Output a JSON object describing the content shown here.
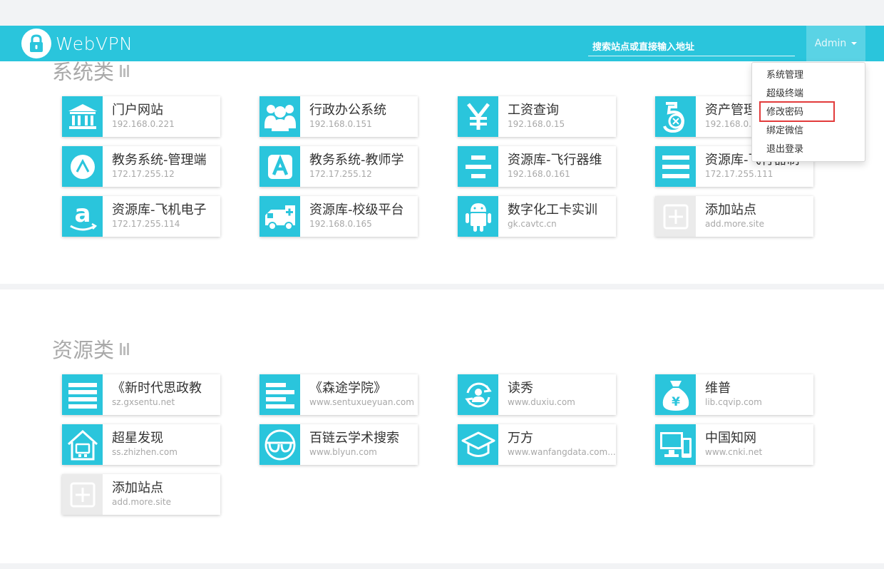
{
  "brand": {
    "name": "WebVPN"
  },
  "search": {
    "placeholder": "搜索站点或直接输入地址"
  },
  "user": {
    "name": "Admin"
  },
  "user_menu": [
    {
      "label": "系统管理"
    },
    {
      "label": "超级终端"
    },
    {
      "label": "修改密码",
      "highlighted": true
    },
    {
      "label": "绑定微信"
    },
    {
      "label": "退出登录"
    }
  ],
  "sections": [
    {
      "title": "系统类",
      "sites": [
        {
          "name": "门户网站",
          "address": "192.168.0.221",
          "icon": "bank-icon"
        },
        {
          "name": "行政办公系统",
          "address": "192.168.0.151",
          "icon": "people-icon"
        },
        {
          "name": "工资查询",
          "address": "192.168.0.15",
          "icon": "yen-icon"
        },
        {
          "name": "资产管理",
          "address": "192.168.0.8",
          "icon": "five-icon"
        },
        {
          "name": "教务系统-管理端",
          "address": "172.17.255.12",
          "icon": "circle-a-icon"
        },
        {
          "name": "教务系统-教师学",
          "address": "172.17.255.12",
          "icon": "square-a-icon"
        },
        {
          "name": "资源库-飞行器维",
          "address": "192.168.0.161",
          "icon": "align-center-icon"
        },
        {
          "name": "资源库-飞行器制",
          "address": "172.17.255.111",
          "icon": "justify-icon"
        },
        {
          "name": "资源库-飞机电子",
          "address": "172.17.255.114",
          "icon": "amazon-icon"
        },
        {
          "name": "资源库-校级平台",
          "address": "192.168.0.165",
          "icon": "ambulance-icon"
        },
        {
          "name": "数字化工卡实训",
          "address": "gk.cavtc.cn",
          "icon": "android-icon"
        },
        {
          "name": "添加站点",
          "address": "add.more.site",
          "icon": "add-icon"
        }
      ]
    },
    {
      "title": "资源类",
      "sites": [
        {
          "name": "《新时代思政教",
          "address": "sz.gxsentu.net",
          "icon": "justify-icon"
        },
        {
          "name": "《森途学院》",
          "address": "www.sentuxueyuan.com",
          "icon": "align-left-icon"
        },
        {
          "name": "读秀",
          "address": "www.duxiu.com",
          "icon": "user-sync-icon"
        },
        {
          "name": "维普",
          "address": "lib.cqvip.com",
          "icon": "money-bag-icon"
        },
        {
          "name": "超星发现",
          "address": "ss.zhizhen.com",
          "icon": "house-icon"
        },
        {
          "name": "百链云学术搜索",
          "address": "www.blyun.com",
          "icon": "glasses-icon"
        },
        {
          "name": "万方",
          "address": "www.wanfangdata.com...",
          "icon": "graduation-cap-icon"
        },
        {
          "name": "中国知网",
          "address": "www.cnki.net",
          "icon": "devices-icon"
        },
        {
          "name": "添加站点",
          "address": "add.more.site",
          "icon": "add-icon"
        }
      ]
    }
  ]
}
